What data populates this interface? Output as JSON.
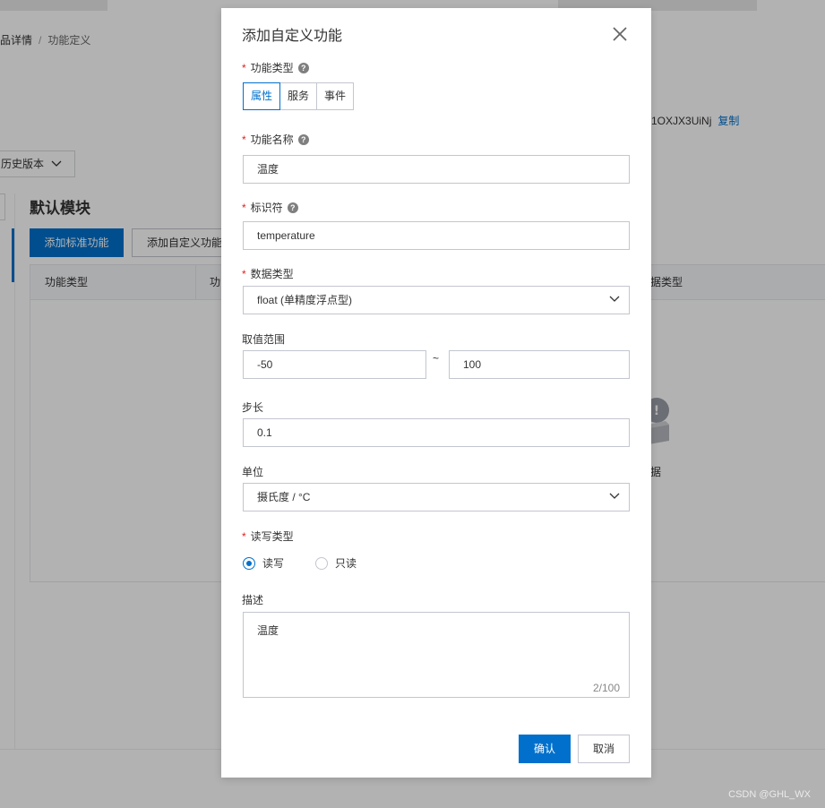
{
  "background": {
    "breadcrumb": {
      "parent": "品详情",
      "separator": "/",
      "current": "功能定义"
    },
    "device_key": "1OXJX3UiNj",
    "copy_label": "复制",
    "history_label": "历史版本",
    "module_title": "默认模块",
    "add_standard_label": "添加标准功能",
    "add_custom_label": "添加自定义功能",
    "table_headers": [
      "功能类型",
      "功",
      "据类型"
    ],
    "empty_text": "据"
  },
  "dialog": {
    "title": "添加自定义功能",
    "function_type": {
      "label": "功能类型",
      "options": [
        "属性",
        "服务",
        "事件"
      ],
      "selected": "属性"
    },
    "function_name": {
      "label": "功能名称",
      "value": "温度"
    },
    "identifier": {
      "label": "标识符",
      "value": "temperature"
    },
    "data_type": {
      "label": "数据类型",
      "value": "float (单精度浮点型)"
    },
    "range": {
      "label": "取值范围",
      "min": "-50",
      "separator": "~",
      "max": "100"
    },
    "step": {
      "label": "步长",
      "value": "0.1"
    },
    "unit": {
      "label": "单位",
      "value": "摄氏度 / °C"
    },
    "rw_type": {
      "label": "读写类型",
      "options": [
        "读写",
        "只读"
      ],
      "selected": "读写"
    },
    "description": {
      "label": "描述",
      "value": "温度",
      "count": "2/100"
    },
    "confirm_label": "确认",
    "cancel_label": "取消"
  },
  "watermark": "CSDN @GHL_WX",
  "colors": {
    "primary": "#0070cc",
    "required": "#e02020",
    "border": "#c4c6cf",
    "overlay": "rgba(0,0,0,0.30)"
  }
}
